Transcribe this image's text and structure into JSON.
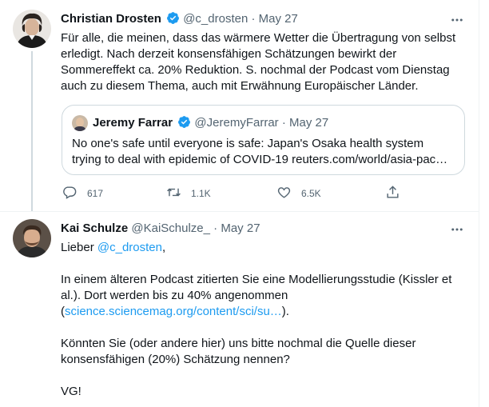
{
  "tweet1": {
    "author_name": "Christian Drosten",
    "handle": "@c_drosten",
    "separator": "·",
    "date": "May 27",
    "text": "Für alle, die meinen, dass das wärmere Wetter die Übertragung von selbst erledigt. Nach derzeit konsensfähigen Schätzungen bewirkt der Sommereffekt ca. 20% Reduktion. S. nochmal der Podcast vom Dienstag auch zu diesem Thema, auch mit Erwähnung Europäischer Länder.",
    "quote": {
      "author_name": "Jeremy Farrar",
      "handle": "@JeremyFarrar",
      "separator": "·",
      "date": "May 27",
      "text": "No one's safe until everyone is safe: Japan's Osaka health system trying to deal with epidemic of COVID-19 reuters.com/world/asia-pac…"
    },
    "actions": {
      "reply_count": "617",
      "retweet_count": "1.1K",
      "like_count": "6.5K"
    }
  },
  "tweet2": {
    "author_name": "Kai Schulze",
    "handle": "@KaiSchulze_",
    "separator": "·",
    "date": "May 27",
    "greeting_prefix": "Lieber ",
    "mention": "@c_drosten",
    "greeting_suffix": ",",
    "paragraph1": "In einem älteren Podcast zitierten Sie eine Modellierungsstudie (Kissler et al.). Dort werden bis zu 40% angenommen",
    "link_open": "(",
    "link": "science.sciencemag.org/content/sci/su…",
    "link_close": ").",
    "paragraph2": "Könnten Sie (oder andere hier) uns bitte nochmal die Quelle dieser konsensfähigen (20%) Schätzung nennen?",
    "signoff": "VG!"
  },
  "colors": {
    "accent": "#1d9bf0",
    "muted": "#536471",
    "text": "#0f1419",
    "border": "#cfd9de"
  },
  "icons": {
    "verified": "verified-badge-icon",
    "more": "more-icon",
    "reply": "reply-icon",
    "retweet": "retweet-icon",
    "like": "like-icon",
    "share": "share-icon"
  }
}
